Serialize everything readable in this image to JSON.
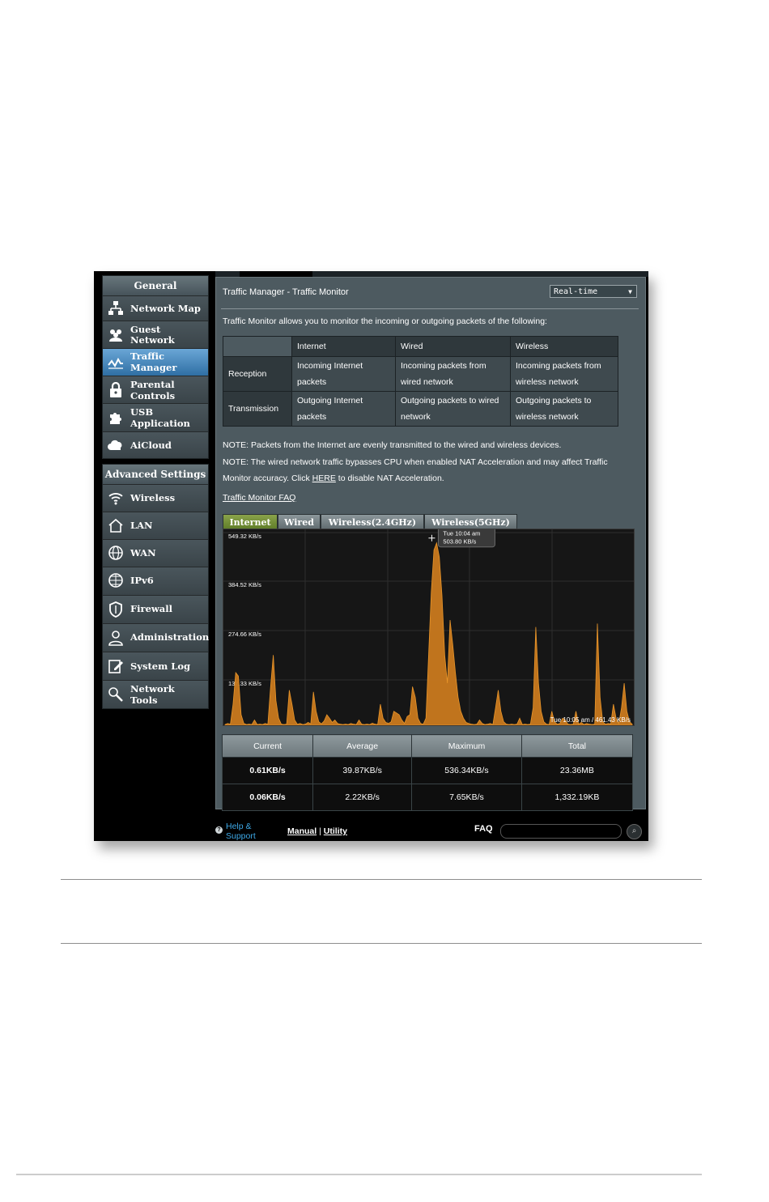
{
  "sidebar": {
    "general_header": "General",
    "general_items": [
      {
        "label_line1": "Network Map",
        "label_line2": "",
        "icon": "network-map-icon"
      },
      {
        "label_line1": "Guest",
        "label_line2": "Network",
        "icon": "guest-network-icon"
      },
      {
        "label_line1": "Traffic",
        "label_line2": "Manager",
        "icon": "traffic-manager-icon"
      },
      {
        "label_line1": "Parental",
        "label_line2": "Controls",
        "icon": "parental-controls-icon"
      },
      {
        "label_line1": "USB",
        "label_line2": "Application",
        "icon": "usb-application-icon"
      },
      {
        "label_line1": "AiCloud",
        "label_line2": "",
        "icon": "aicloud-icon"
      }
    ],
    "advanced_header": "Advanced Settings",
    "advanced_items": [
      {
        "label_line1": "Wireless",
        "label_line2": "",
        "icon": "wireless-icon"
      },
      {
        "label_line1": "LAN",
        "label_line2": "",
        "icon": "lan-icon"
      },
      {
        "label_line1": "WAN",
        "label_line2": "",
        "icon": "wan-icon"
      },
      {
        "label_line1": "IPv6",
        "label_line2": "",
        "icon": "ipv6-icon"
      },
      {
        "label_line1": "Firewall",
        "label_line2": "",
        "icon": "firewall-icon"
      },
      {
        "label_line1": "Administration",
        "label_line2": "",
        "icon": "administration-icon"
      },
      {
        "label_line1": "System Log",
        "label_line2": "",
        "icon": "system-log-icon"
      },
      {
        "label_line1": "Network",
        "label_line2": "Tools",
        "icon": "network-tools-icon"
      }
    ]
  },
  "main": {
    "title": "Traffic Manager - Traffic Monitor",
    "mode_select": "Real-time",
    "description": "Traffic Monitor allows you to monitor the incoming or outgoing packets of the following:",
    "info_table": {
      "columns": [
        "Internet",
        "Wired",
        "Wireless"
      ],
      "rows": [
        {
          "label": "Reception",
          "cells": [
            "Incoming Internet packets",
            "Incoming packets from wired network",
            "Incoming packets from wireless network"
          ]
        },
        {
          "label": "Transmission",
          "cells": [
            "Outgoing Internet packets",
            "Outgoing packets to wired network",
            "Outgoing packets to wireless network"
          ]
        }
      ]
    },
    "note1": "NOTE: Packets from the Internet are evenly transmitted to the wired and wireless devices.",
    "note2_line1": "NOTE: The wired network traffic bypasses CPU when enabled NAT Acceleration and may affect Traffic",
    "note2_line2_pre": "Monitor accuracy. Click ",
    "note2_link": "HERE",
    "note2_line2_post": " to disable NAT Acceleration.",
    "faq_link": "Traffic Monitor FAQ",
    "tabs": [
      "Internet",
      "Wired",
      "Wireless(2.4GHz)",
      "Wireless(5GHz)"
    ],
    "active_tab": "Internet",
    "stats": {
      "headers": [
        "Current",
        "Average",
        "Maximum",
        "Total"
      ],
      "rows": [
        [
          "0.61KB/s",
          "39.87KB/s",
          "536.34KB/s",
          "23.36MB"
        ],
        [
          "0.06KB/s",
          "2.22KB/s",
          "7.65KB/s",
          "1,332.19KB"
        ]
      ]
    }
  },
  "chart_data": {
    "type": "area",
    "y_tick_labels": [
      "549.32 KB/s",
      "384.52 KB/s",
      "274.66 KB/s",
      "137.33 KB/s"
    ],
    "ylim": [
      0,
      549.32
    ],
    "tooltip_line1": "Tue 10:04 am",
    "tooltip_line2": "503.80 KB/s",
    "footer_label": "Tue 10:05 am / 461.43 KB/s",
    "grid": true,
    "fill_color": "#c9791e",
    "values": [
      2,
      5,
      3,
      60,
      150,
      140,
      30,
      5,
      2,
      3,
      2,
      15,
      2,
      3,
      2,
      5,
      3,
      110,
      200,
      70,
      20,
      3,
      2,
      3,
      100,
      60,
      15,
      3,
      5,
      2,
      3,
      8,
      4,
      95,
      40,
      10,
      4,
      12,
      30,
      20,
      8,
      15,
      5,
      3,
      2,
      3,
      2,
      5,
      3,
      2,
      15,
      3,
      2,
      3,
      2,
      6,
      3,
      2,
      60,
      20,
      8,
      5,
      10,
      40,
      35,
      30,
      15,
      5,
      25,
      30,
      110,
      80,
      20,
      5,
      3,
      20,
      200,
      380,
      500,
      520,
      480,
      370,
      200,
      120,
      300,
      230,
      150,
      80,
      40,
      20,
      8,
      5,
      3,
      2,
      3,
      15,
      5,
      2,
      3,
      5,
      2,
      50,
      100,
      40,
      10,
      3,
      2,
      3,
      2,
      3,
      20,
      2,
      3,
      2,
      3,
      50,
      280,
      120,
      40,
      10,
      3,
      2,
      40,
      10,
      3,
      5,
      20,
      15,
      3,
      2,
      3,
      40,
      3,
      8,
      2,
      5,
      3,
      2,
      3,
      290,
      80,
      10,
      3,
      5,
      4,
      60,
      20,
      5,
      50,
      120,
      40,
      10,
      3
    ]
  },
  "footer": {
    "help_line1": "Help &",
    "help_line2": "Support",
    "manual": "Manual",
    "divider": "|",
    "utility": "Utility",
    "faq": "FAQ"
  },
  "colors": {
    "orange_text": "#f08a24",
    "blue_text": "#3da8e6",
    "active_tab": "#6f8f34",
    "active_menu": "#4a8bc4"
  }
}
